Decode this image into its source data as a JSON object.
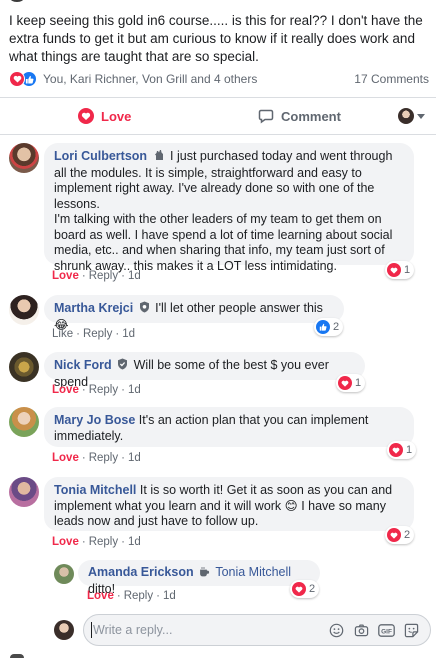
{
  "post": {
    "text": "I keep seeing this gold in6 course..... is this for real?? I don't have the extra funds to get it but am curious to know if it really does work and what things are taught that are so special."
  },
  "reactions": {
    "summary": "You, Kari Richner, Von Grill and 4 others",
    "comment_count": "17 Comments",
    "icons": [
      "heart-icon",
      "thumbs-up-icon"
    ]
  },
  "actions": {
    "love_label": "Love",
    "comment_label": "Comment"
  },
  "colors": {
    "love": "#f0284a",
    "like": "#1877f2",
    "author": "#385898",
    "bubble_bg": "#f2f3f5",
    "meta": "#606770"
  },
  "comments": [
    {
      "author": "Lori Culbertson",
      "badge": "rising-fan-icon",
      "text": "I just purchased today and went through all the modules. It is simple, straightforward and easy to implement right away. I've already done so with one of the lessons.\nI'm talking with the other leaders of my team to get them on board as well. I have spend a lot of time learning about social media, etc.. and when sharing that info, my team just sort of shrunk away.. this makes it a LOT less intimidating.",
      "reaction_label": "Love",
      "reply_label": "Reply",
      "time": "1d",
      "reaction_count": "1",
      "reaction_type": "heart"
    },
    {
      "author": "Martha Krejci",
      "badge": "admin-shield-icon",
      "text": "I'll let other people answer this",
      "emoji": "😂",
      "reaction_label": "Like",
      "reply_label": "Reply",
      "time": "1d",
      "reaction_count": "2",
      "reaction_type": "like"
    },
    {
      "author": "Nick Ford",
      "badge": "admin-shield-icon",
      "text": "Will be some of the best $ you ever spend",
      "reaction_label": "Love",
      "reply_label": "Reply",
      "time": "1d",
      "reaction_count": "1",
      "reaction_type": "heart"
    },
    {
      "author": "Mary Jo Bose",
      "text": "It's an action plan that you can implement immediately.",
      "reaction_label": "Love",
      "reply_label": "Reply",
      "time": "1d",
      "reaction_count": "1",
      "reaction_type": "heart"
    },
    {
      "author": "Tonia Mitchell",
      "text": "It is so worth it! Get it as soon as you can and implement what you learn and it will work",
      "text_after": "I have so many leads now and just have to follow up.",
      "emoji": "😊",
      "reaction_label": "Love",
      "reply_label": "Reply",
      "time": "1d",
      "reaction_count": "2",
      "reaction_type": "heart"
    }
  ],
  "reply": {
    "author": "Amanda Erickson",
    "badge": "coffee-icon",
    "mention": "Tonia Mitchell",
    "text": "ditto!",
    "reaction_label": "Love",
    "reply_label": "Reply",
    "time": "1d",
    "reaction_count": "2",
    "reaction_type": "heart"
  },
  "reply_box": {
    "placeholder": "Write a reply...",
    "icons": [
      "emoji-icon",
      "camera-icon",
      "gif-icon",
      "sticker-icon"
    ]
  }
}
